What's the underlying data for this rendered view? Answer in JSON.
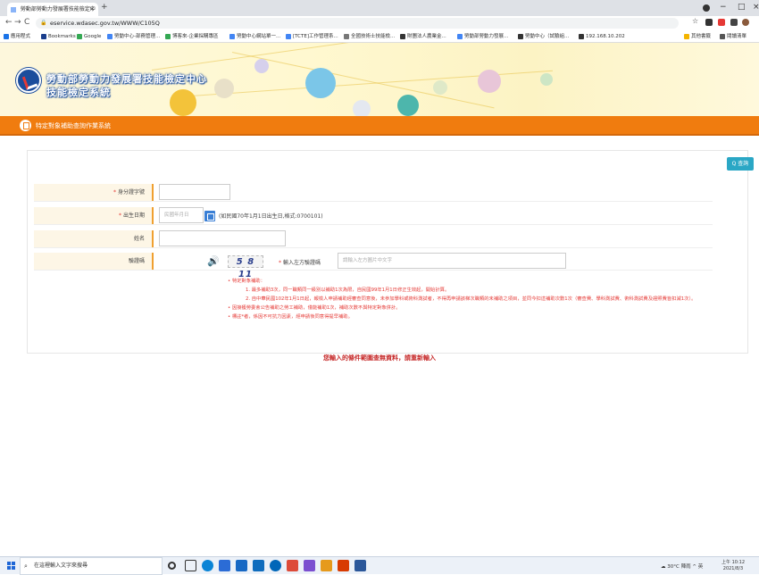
{
  "browser": {
    "tab_title": "勞動部勞動力發展署技能檢定中",
    "tab_close": "×",
    "new_tab": "+",
    "url": "eservice.wdasec.gov.tw/WWW/C105Q",
    "window_controls": [
      "−",
      "□",
      "×"
    ],
    "nav": {
      "back": "←",
      "forward": "→",
      "reload": "C"
    },
    "bookmarks": [
      "應用程式",
      "Bookmarks",
      "Google",
      "勞動中心-部務管理...",
      "博客來-企業採購專區",
      "勞動中心網站單一...",
      "[TCTE]工作管理系...",
      "全國技術士技能檢...",
      "財團法人農業金...",
      "勞動部勞動力發展...",
      "勞動中心（試驗組...",
      "192.168.10.202",
      "其他書籤",
      "閱讀清單"
    ]
  },
  "site": {
    "title": "勞動部勞動力發展署技能檢定中心",
    "subtitle": "技能檢定系統",
    "system_name": "特定對象補助查詢作業系統"
  },
  "form": {
    "query_button": "Q 查詢",
    "id_label": "身分證字號",
    "id_value": "",
    "birth_label": "出生日期",
    "birth_placeholder": "民國年月日",
    "birth_hint": "(如民國70年1月1日出生日,格式:0700101)",
    "name_label": "姓名",
    "name_value": "",
    "captcha_label": "驗證碼",
    "captcha_image_text": "5 8 11",
    "captcha_input_label": "輸入左方驗證碼",
    "captcha_placeholder": "請輸入左方圖片中文字",
    "required_mark": "*"
  },
  "notes": {
    "heading": "特定對象補助：",
    "item1": "1. 最多補助3次，同一職類同一級別以補助1次為限，自民國99年1月1日修正生效起，開始計算。",
    "item2": "2. 自中華民國102年1月1日起，報檢人申請補助經審查同意後，未參加學科或術科測試者，不得再申請該梯次職類的未補助之項目，並同今扣這補助次數1次（審查費、學科測試費、術科測試費及證照費皆扣減1次）。",
    "item3": "因接獲勞委會公告補助之勞工補助，僅能補助1次，補助次數不與特定對象併計。",
    "item4": "標註*者，係因不可抗力因素，經申請後同意得提早補助。"
  },
  "result_message": "您輸入的條件範圍查無資料，請重新輸入",
  "taskbar": {
    "search_placeholder": "在這裡輸入文字來搜尋",
    "weather": "30°C 陣雨",
    "lang": "英",
    "time": "上午 10:12",
    "date": "2021/8/3"
  },
  "colors": {
    "accent_orange": "#f07c0f",
    "query_button": "#2aa7c5",
    "warning_red": "#e53935"
  }
}
